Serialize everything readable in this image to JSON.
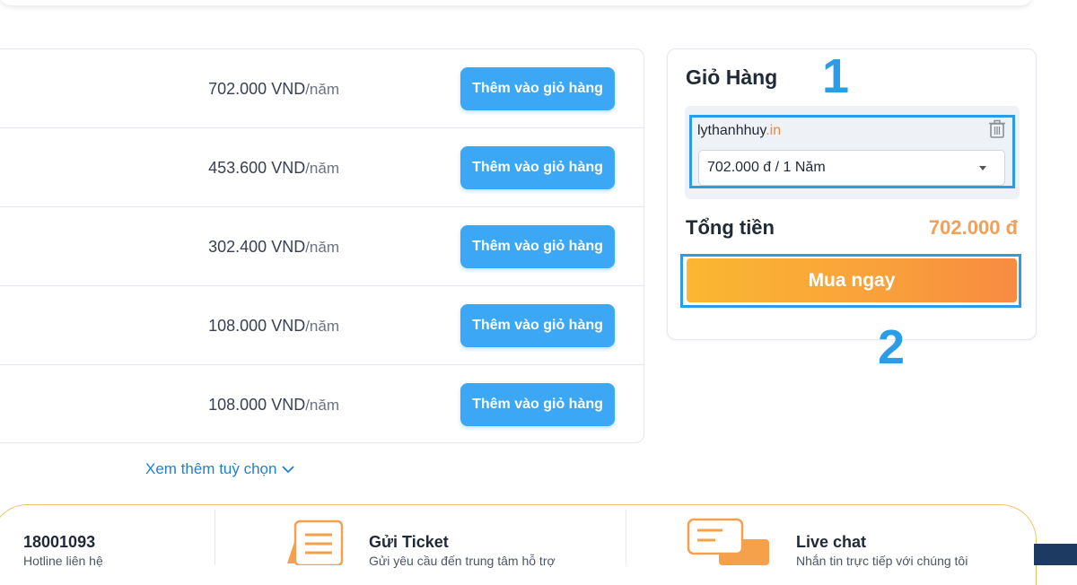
{
  "products": [
    {
      "price": "702.000 VND",
      "unit": "/năm",
      "button_label": "Thêm vào giỏ hàng"
    },
    {
      "price": "453.600 VND",
      "unit": "/năm",
      "button_label": "Thêm vào giỏ hàng"
    },
    {
      "price": "302.400 VND",
      "unit": "/năm",
      "button_label": "Thêm vào giỏ hàng"
    },
    {
      "price": "108.000 VND",
      "unit": "/năm",
      "button_label": "Thêm vào giỏ hàng"
    },
    {
      "price": "108.000 VND",
      "unit": "/năm",
      "button_label": "Thêm vào giỏ hàng"
    }
  ],
  "more_options_label": "Xem thêm tuỳ chọn",
  "cart": {
    "title": "Giỏ Hàng",
    "item": {
      "domain_name": "lythanhhuy",
      "domain_tld": ".in",
      "selected_period": "702.000 đ / 1 Năm"
    },
    "total_label": "Tổng tiền",
    "total_value": "702.000 đ",
    "buy_label": "Mua ngay"
  },
  "annotations": {
    "one": "1",
    "two": "2"
  },
  "support": {
    "hotline": {
      "title": "18001093",
      "subtitle": "Hotline liên hệ"
    },
    "ticket": {
      "title": "Gửi Ticket",
      "subtitle": "Gửi yêu cầu đến trung tâm hỗ trợ"
    },
    "chat": {
      "title": "Live chat",
      "subtitle": "Nhắn tin trực tiếp với chúng tôi"
    }
  },
  "colors": {
    "primary_blue": "#3ba7f5",
    "annotation_blue": "#2b9de8",
    "accent_orange": "#f2a057",
    "tld_orange": "#f2873d"
  }
}
